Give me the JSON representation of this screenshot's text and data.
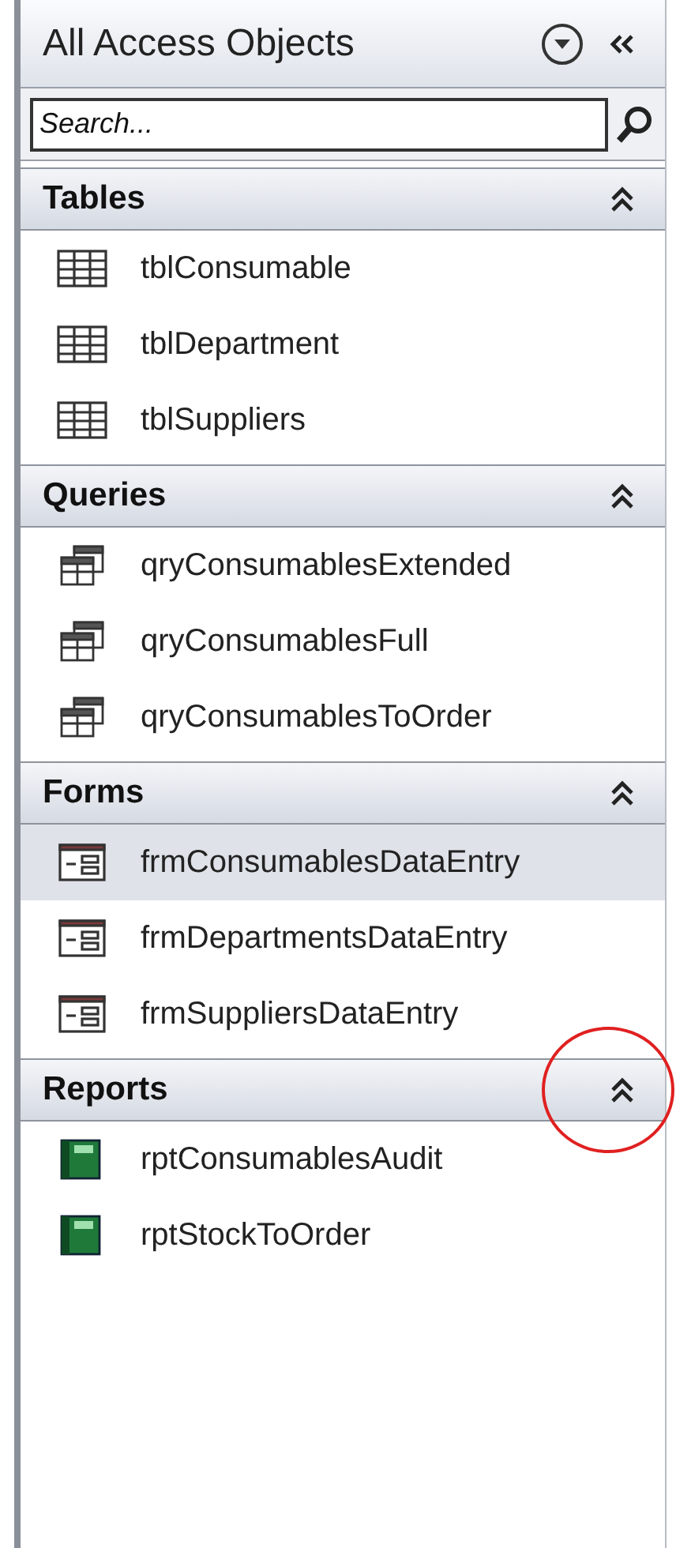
{
  "pane": {
    "title": "All Access Objects"
  },
  "search": {
    "placeholder": "Search..."
  },
  "groups": [
    {
      "name": "Tables",
      "kind": "table",
      "expanded": true,
      "circled": false,
      "items": [
        {
          "label": "tblConsumable",
          "selected": false
        },
        {
          "label": "tblDepartment",
          "selected": false
        },
        {
          "label": "tblSuppliers",
          "selected": false
        }
      ]
    },
    {
      "name": "Queries",
      "kind": "query",
      "expanded": true,
      "circled": false,
      "items": [
        {
          "label": "qryConsumablesExtended",
          "selected": false
        },
        {
          "label": "qryConsumablesFull",
          "selected": false
        },
        {
          "label": "qryConsumablesToOrder",
          "selected": false
        }
      ]
    },
    {
      "name": "Forms",
      "kind": "form",
      "expanded": true,
      "circled": false,
      "items": [
        {
          "label": "frmConsumablesDataEntry",
          "selected": true
        },
        {
          "label": "frmDepartmentsDataEntry",
          "selected": false
        },
        {
          "label": "frmSuppliersDataEntry",
          "selected": false
        }
      ]
    },
    {
      "name": "Reports",
      "kind": "report",
      "expanded": true,
      "circled": true,
      "items": [
        {
          "label": "rptConsumablesAudit",
          "selected": false
        },
        {
          "label": "rptStockToOrder",
          "selected": false
        }
      ]
    }
  ]
}
